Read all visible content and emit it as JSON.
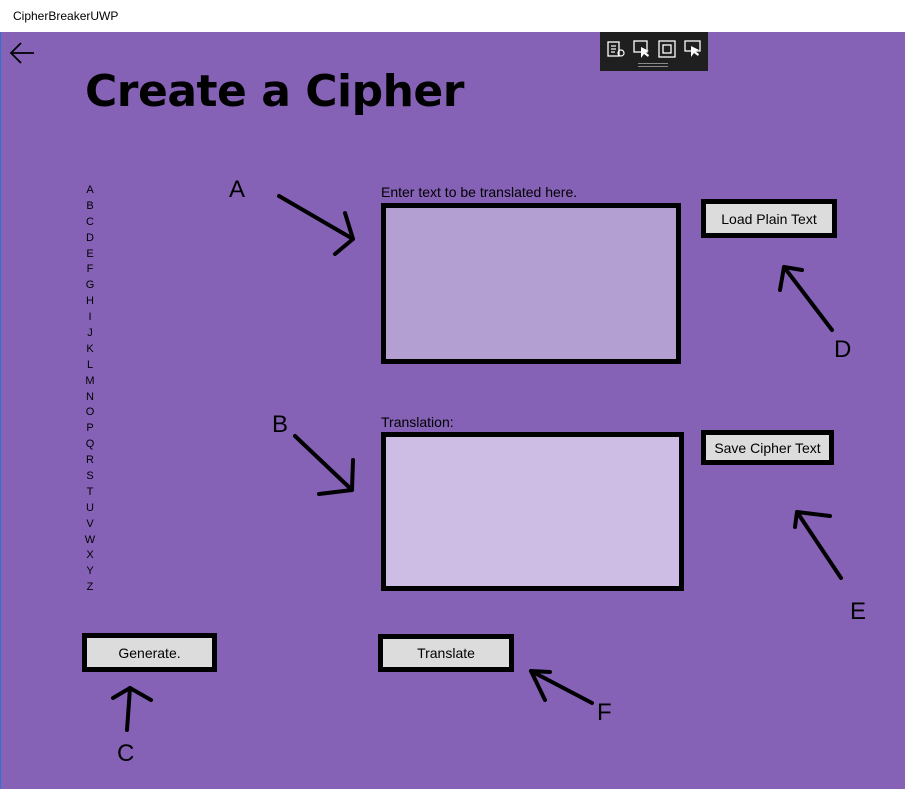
{
  "window": {
    "title": "CipherBreakerUWP"
  },
  "page": {
    "title": "Create a Cipher"
  },
  "alphabet": [
    "A",
    "B",
    "C",
    "D",
    "E",
    "F",
    "G",
    "H",
    "I",
    "J",
    "K",
    "L",
    "M",
    "N",
    "O",
    "P",
    "Q",
    "R",
    "S",
    "T",
    "U",
    "V",
    "W",
    "X",
    "Y",
    "Z"
  ],
  "input": {
    "label": "Enter text to be translated here.",
    "value": ""
  },
  "output": {
    "label": "Translation:",
    "value": ""
  },
  "buttons": {
    "load": "Load Plain Text",
    "save": "Save Cipher Text",
    "generate": "Generate.",
    "translate": "Translate"
  },
  "annotations": [
    "A",
    "B",
    "C",
    "D",
    "E",
    "F"
  ],
  "colors": {
    "background": "#8562b6",
    "input_fill": "#b49fd3",
    "output_fill": "#cdbde4",
    "button_fill": "#dcdcdc"
  },
  "icons": {
    "back": "back-arrow-icon",
    "toolbar": [
      "live-visual-tree-icon",
      "select-element-icon",
      "display-layout-adorners-icon",
      "track-focus-icon"
    ]
  }
}
